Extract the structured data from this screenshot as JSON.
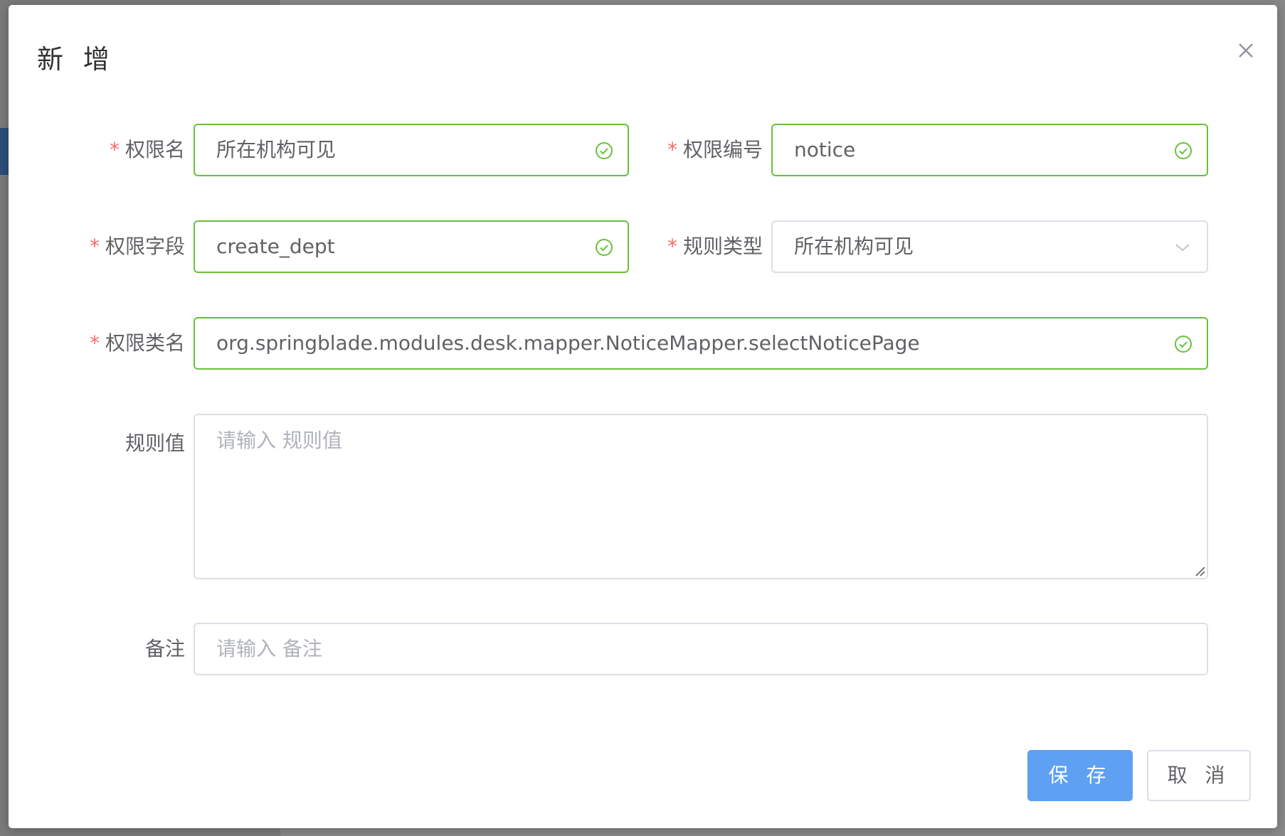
{
  "dialog": {
    "title": "新 增",
    "close_icon": "close-icon"
  },
  "form": {
    "required_mark": "*",
    "perm_name": {
      "label": "权限名",
      "value": "所在机构可见"
    },
    "perm_code": {
      "label": "权限编号",
      "value": "notice"
    },
    "perm_field": {
      "label": "权限字段",
      "value": "create_dept"
    },
    "rule_type": {
      "label": "规则类型",
      "selected": "所在机构可见"
    },
    "perm_class": {
      "label": "权限类名",
      "value": "org.springblade.modules.desk.mapper.NoticeMapper.selectNoticePage"
    },
    "rule_value": {
      "label": "规则值",
      "placeholder": "请输入 规则值"
    },
    "remark": {
      "label": "备注",
      "placeholder": "请输入 备注"
    }
  },
  "footer": {
    "save_label": "保 存",
    "cancel_label": "取 消"
  },
  "colors": {
    "success": "#67c23a",
    "primary": "#5ea0f2",
    "required": "#f56c6c"
  }
}
